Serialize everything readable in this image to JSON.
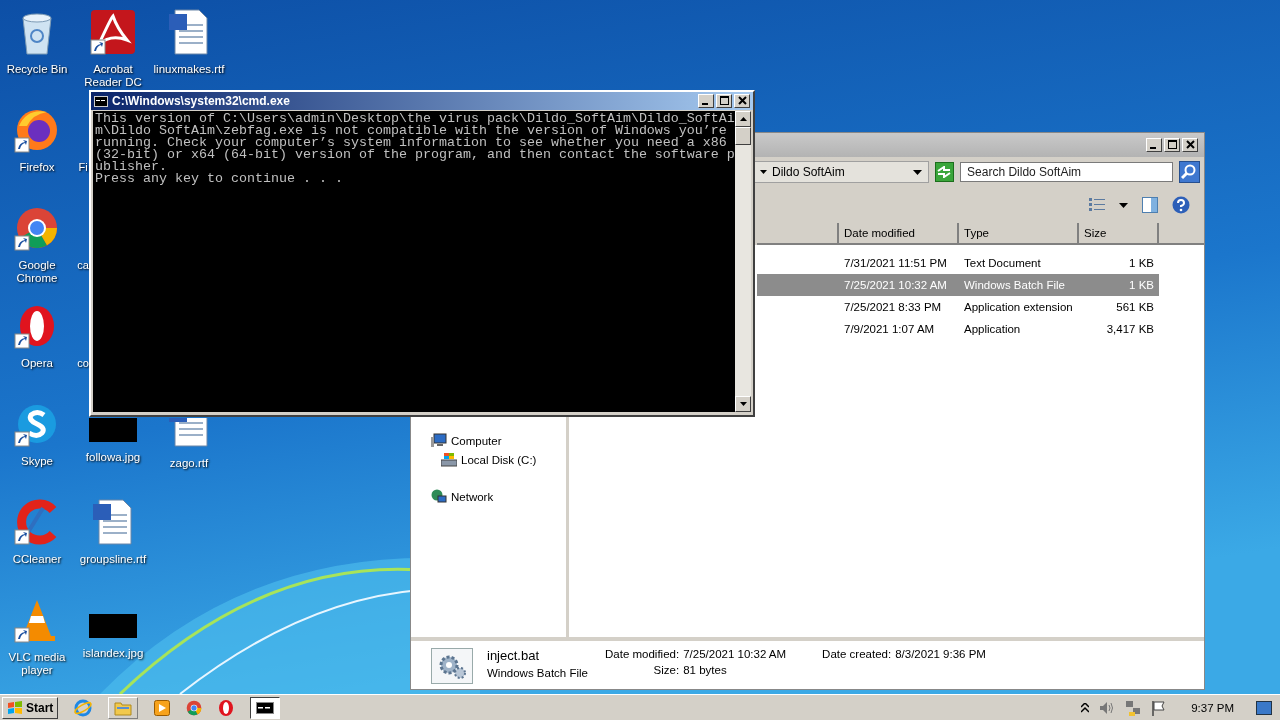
{
  "desktop": {
    "columns": [
      [
        {
          "label": "Recycle Bin",
          "kind": "recycle",
          "shortcut": false
        },
        {
          "label": "Firefox",
          "kind": "firefox",
          "shortcut": true
        },
        {
          "label": "Google Chrome",
          "kind": "chrome",
          "shortcut": true
        },
        {
          "label": "Opera",
          "kind": "opera",
          "shortcut": true
        },
        {
          "label": "Skype",
          "kind": "skype",
          "shortcut": true
        },
        {
          "label": "CCleaner",
          "kind": "ccleaner",
          "shortcut": true
        },
        {
          "label": "VLC media player",
          "kind": "vlc",
          "shortcut": true
        }
      ],
      [
        {
          "label": "Acrobat Reader DC",
          "kind": "pdf",
          "shortcut": true
        },
        {
          "label": "Fi",
          "kind": "covered"
        },
        {
          "label": "ca",
          "kind": "covered"
        },
        {
          "label": "co",
          "kind": "covered"
        },
        {
          "label": "followa.jpg",
          "kind": "image",
          "shortcut": false
        },
        {
          "label": "groupsline.rtf",
          "kind": "word",
          "shortcut": false
        },
        {
          "label": "islandex.jpg",
          "kind": "image",
          "shortcut": false
        }
      ],
      [
        {
          "label": "linuxmakes.rtf",
          "kind": "word",
          "shortcut": false
        },
        null,
        null,
        null,
        {
          "label": "zago.rtf",
          "kind": "word",
          "shortcut": false
        }
      ]
    ]
  },
  "explorer": {
    "breadcrumb": "Dildo SoftAim",
    "search": {
      "placeholder": "Search Dildo SoftAim"
    },
    "columns": [
      "Date modified",
      "Type",
      "Size"
    ],
    "rows": [
      {
        "date_modified": "7/31/2021 11:51 PM",
        "type": "Text Document",
        "size": "1 KB",
        "selected": false
      },
      {
        "date_modified": "7/25/2021 10:32 AM",
        "type": "Windows Batch File",
        "size": "1 KB",
        "selected": true
      },
      {
        "date_modified": "7/25/2021 8:33 PM",
        "type": "Application extension",
        "size": "561 KB",
        "selected": false
      },
      {
        "date_modified": "7/9/2021 1:07 AM",
        "type": "Application",
        "size": "3,417 KB",
        "selected": false
      }
    ],
    "nav": [
      {
        "label": "Computer",
        "kind": "computer",
        "children": [
          {
            "label": "Local Disk (C:)",
            "kind": "disk"
          }
        ]
      },
      {
        "label": "Network",
        "kind": "network"
      }
    ],
    "details": {
      "name": "inject.bat",
      "type": "Windows Batch File",
      "field_columns": [
        [
          {
            "label": "Date modified:",
            "value": "7/25/2021 10:32 AM"
          },
          {
            "label": "Size:",
            "value": "81 bytes"
          }
        ],
        [
          {
            "label": "Date created:",
            "value": "8/3/2021 9:36 PM"
          }
        ]
      ]
    }
  },
  "console": {
    "title": "C:\\Windows\\system32\\cmd.exe",
    "lines": [
      "This version of C:\\Users\\admin\\Desktop\\the virus pack\\Dildo_SoftAim\\Dildo_SoftAi",
      "m\\Dildo SoftAim\\zebfag.exe is not compatible with the version of Windows you’re",
      "running. Check your computer’s system information to see whether you need a x86",
      "(32-bit) or x64 (64-bit) version of the program, and then contact the software p",
      "ublisher.",
      "Press any key to continue . . ."
    ]
  },
  "taskbar": {
    "start": "Start",
    "quick_launch": [
      {
        "kind": "ie"
      },
      {
        "kind": "folder"
      },
      {
        "kind": "media"
      },
      {
        "kind": "chrome"
      },
      {
        "kind": "opera"
      }
    ],
    "tasks": [
      {
        "kind": "console",
        "selected": true
      }
    ],
    "clock": "9:37 PM"
  }
}
